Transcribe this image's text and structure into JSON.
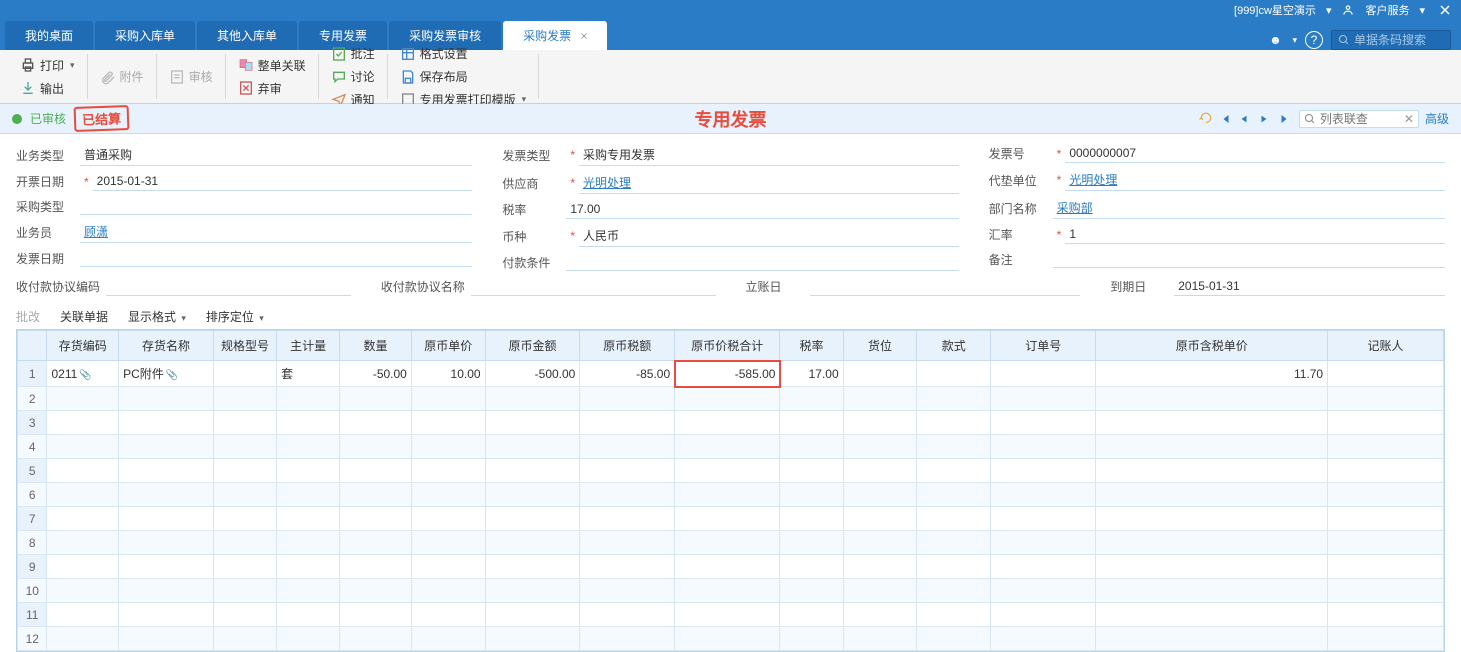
{
  "titlebar": {
    "app": "[999]cw星空演示",
    "service": "客户服务"
  },
  "tabs": {
    "items": [
      "我的桌面",
      "采购入库单",
      "其他入库单",
      "专用发票",
      "采购发票审核"
    ],
    "active": "采购发票"
  },
  "search": {
    "placeholder": "单据条码搜索"
  },
  "toolbar": {
    "print": "打印",
    "export": "输出",
    "attach": "附件",
    "audit": "审核",
    "relate": "整单关联",
    "discard": "弃审",
    "approve": "批注",
    "discuss": "讨论",
    "notify": "通知",
    "format": "格式设置",
    "savelayout": "保存布局",
    "printtpl": "专用发票打印模版"
  },
  "status": {
    "approved": "已审核",
    "settled": "已结算",
    "title": "专用发票",
    "relate_search": "列表联查",
    "advanced": "高级"
  },
  "form": {
    "biz_type_lbl": "业务类型",
    "biz_type": "普通采购",
    "inv_date_lbl": "开票日期",
    "inv_date": "2015-01-31",
    "purch_type_lbl": "采购类型",
    "purch_type": "",
    "clerk_lbl": "业务员",
    "clerk": "顾潇",
    "fapiao_date_lbl": "发票日期",
    "fapiao_date": "",
    "inv_type_lbl": "发票类型",
    "inv_type": "采购专用发票",
    "supplier_lbl": "供应商",
    "supplier": "光明处理",
    "tax_rate_lbl": "税率",
    "tax_rate": "17.00",
    "currency_lbl": "币种",
    "currency": "人民币",
    "payterm_lbl": "付款条件",
    "payterm": "",
    "inv_no_lbl": "发票号",
    "inv_no": "0000000007",
    "agent_lbl": "代垫单位",
    "agent": "光明处理",
    "dept_lbl": "部门名称",
    "dept": "采购部",
    "rate_lbl": "汇率",
    "rate": "1",
    "remark_lbl": "备注",
    "remark": "",
    "agree_code_lbl": "收付款协议编码",
    "agree_name_lbl": "收付款协议名称",
    "acct_date_lbl": "立账日",
    "due_date_lbl": "到期日",
    "due_date": "2015-01-31"
  },
  "grid_tb": {
    "batch": "批改",
    "relate": "关联单据",
    "display": "显示格式",
    "sort": "排序定位"
  },
  "grid": {
    "headers": [
      "存货编码",
      "存货名称",
      "规格型号",
      "主计量",
      "数量",
      "原币单价",
      "原币金额",
      "原币税额",
      "原币价税合计",
      "税率",
      "货位",
      "款式",
      "订单号",
      "原币含税单价",
      "记账人"
    ],
    "rows": [
      {
        "code": "0211",
        "name": "PC附件",
        "spec": "",
        "uom": "套",
        "qty": "-50.00",
        "price": "10.00",
        "amount": "-500.00",
        "tax": "-85.00",
        "total": "-585.00",
        "taxrate": "17.00",
        "loc": "",
        "style": "",
        "order": "",
        "taxprice": "11.70",
        "booker": ""
      }
    ],
    "empty_rows": 11
  }
}
